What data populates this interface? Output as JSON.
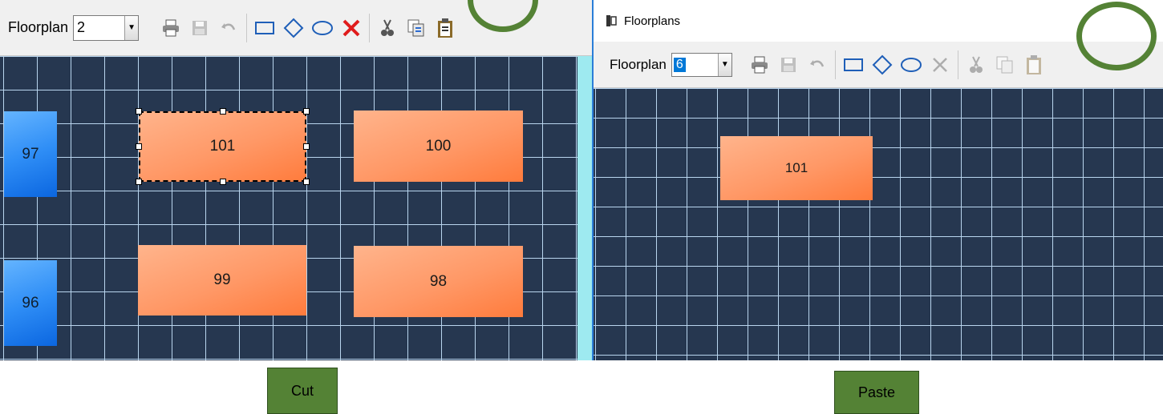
{
  "left_window": {
    "floorplan_label": "Floorplan",
    "floorplan_value": "2",
    "toolbar_icons": [
      "printer-icon",
      "save-icon",
      "undo-icon",
      "rectangle-icon",
      "diamond-icon",
      "ellipse-icon",
      "delete-icon",
      "cut-icon",
      "copy-icon",
      "paste-icon"
    ],
    "rooms": [
      {
        "label": "97",
        "color": "blue"
      },
      {
        "label": "101",
        "color": "orange",
        "selected": true
      },
      {
        "label": "100",
        "color": "orange"
      },
      {
        "label": "96",
        "color": "blue"
      },
      {
        "label": "99",
        "color": "orange"
      },
      {
        "label": "98",
        "color": "orange"
      }
    ]
  },
  "right_window": {
    "title": "Floorplans",
    "floorplan_label": "Floorplan",
    "floorplan_value": "6",
    "rooms": [
      {
        "label": "101",
        "color": "orange"
      }
    ]
  },
  "captions": {
    "cut": "Cut",
    "paste": "Paste"
  },
  "colors": {
    "grid_bg": "#263750",
    "grid_line": "#b9d5ee",
    "annotation_green": "#548235",
    "delete_red": "#e01c1c"
  }
}
